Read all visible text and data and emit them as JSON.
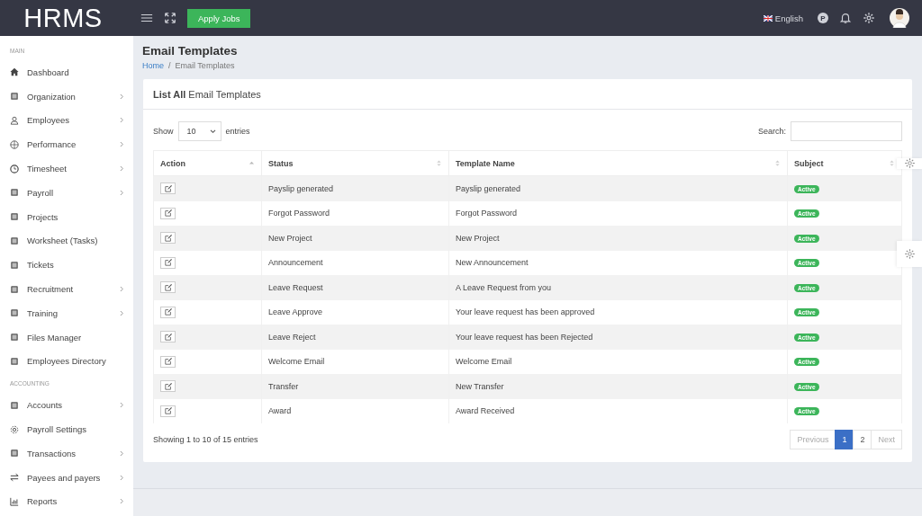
{
  "topbar": {
    "logo": "HRMS",
    "apply_button": "Apply Jobs",
    "language": "English",
    "profile_badge": "P"
  },
  "sidebar": {
    "sections": [
      {
        "title": "MAIN",
        "items": [
          {
            "label": "Dashboard",
            "has_submenu": false
          },
          {
            "label": "Organization",
            "has_submenu": true
          },
          {
            "label": "Employees",
            "has_submenu": true
          },
          {
            "label": "Performance",
            "has_submenu": true
          },
          {
            "label": "Timesheet",
            "has_submenu": true
          },
          {
            "label": "Payroll",
            "has_submenu": true
          },
          {
            "label": "Projects",
            "has_submenu": false
          },
          {
            "label": "Worksheet (Tasks)",
            "has_submenu": false
          },
          {
            "label": "Tickets",
            "has_submenu": false
          },
          {
            "label": "Recruitment",
            "has_submenu": true
          },
          {
            "label": "Training",
            "has_submenu": true
          },
          {
            "label": "Files Manager",
            "has_submenu": false
          },
          {
            "label": "Employees Directory",
            "has_submenu": false
          }
        ]
      },
      {
        "title": "ACCOUNTING",
        "items": [
          {
            "label": "Accounts",
            "has_submenu": true
          },
          {
            "label": "Payroll Settings",
            "has_submenu": false
          },
          {
            "label": "Transactions",
            "has_submenu": true
          },
          {
            "label": "Payees and payers",
            "has_submenu": true
          },
          {
            "label": "Reports",
            "has_submenu": true
          }
        ]
      }
    ]
  },
  "page": {
    "title": "Email Templates",
    "breadcrumb_separator": "/",
    "breadcrumb": [
      {
        "label": "Home",
        "link": true
      },
      {
        "label": "Email Templates",
        "link": false
      }
    ]
  },
  "card": {
    "title": "**List All** Email Templates",
    "length_control": {
      "before": "Show",
      "value": "10",
      "after": "entries"
    },
    "search": {
      "label": "Search:"
    },
    "table": {
      "columns": [
        {
          "label": "Action",
          "sorted": true
        },
        {
          "label": "Status",
          "sorted": false
        },
        {
          "label": "Template Name",
          "sorted": false
        },
        {
          "label": "Subject",
          "sorted": false
        }
      ],
      "rows": [
        {
          "status": "Payslip generated",
          "template_name": "Payslip generated",
          "subject": "Active"
        },
        {
          "status": "Forgot Password",
          "template_name": "Forgot Password",
          "subject": "Active"
        },
        {
          "status": "New Project",
          "template_name": "New Project",
          "subject": "Active"
        },
        {
          "status": "Announcement",
          "template_name": "New Announcement",
          "subject": "Active"
        },
        {
          "status": "Leave Request",
          "template_name": "A Leave Request from you",
          "subject": "Active"
        },
        {
          "status": "Leave Approve",
          "template_name": "Your leave request has been approved",
          "subject": "Active"
        },
        {
          "status": "Leave Reject",
          "template_name": "Your leave request has been Rejected",
          "subject": "Active"
        },
        {
          "status": "Welcome Email",
          "template_name": "Welcome Email",
          "subject": "Active"
        },
        {
          "status": "Transfer",
          "template_name": "New Transfer",
          "subject": "Active"
        },
        {
          "status": "Award",
          "template_name": "Award Received",
          "subject": "Active"
        }
      ]
    },
    "info": "Showing 1 to 10 of 15 entries",
    "pagination": [
      {
        "label": "Previous",
        "selected": false,
        "disabled": true
      },
      {
        "label": "1",
        "selected": true,
        "disabled": false
      },
      {
        "label": "2",
        "selected": false,
        "disabled": false
      },
      {
        "label": "Next",
        "selected": false,
        "disabled": true
      }
    ]
  }
}
